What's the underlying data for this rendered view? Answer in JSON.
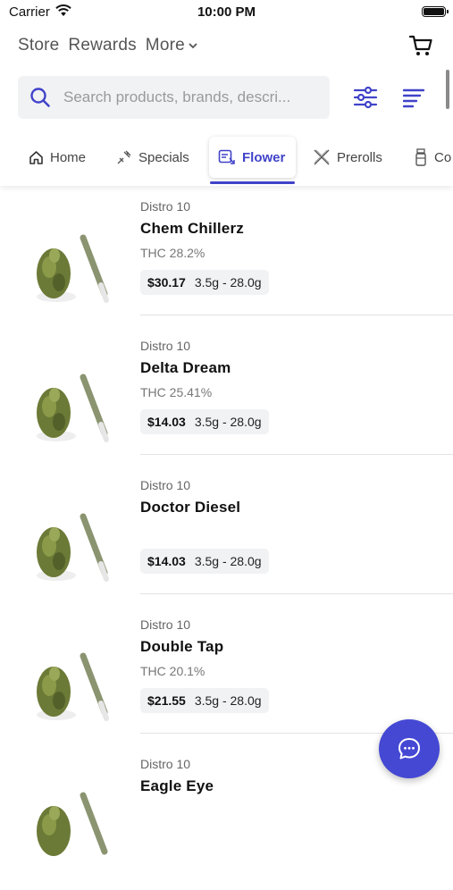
{
  "status": {
    "carrier": "Carrier",
    "time": "10:00 PM"
  },
  "nav": {
    "store": "Store",
    "rewards": "Rewards",
    "more": "More"
  },
  "search": {
    "placeholder": "Search products, brands, descri..."
  },
  "tabs": [
    {
      "label": "Home",
      "icon": "home-icon"
    },
    {
      "label": "Specials",
      "icon": "specials-icon"
    },
    {
      "label": "Flower",
      "icon": "flower-icon",
      "active": true
    },
    {
      "label": "Prerolls",
      "icon": "prerolls-icon"
    },
    {
      "label": "Co",
      "icon": "concentrates-icon"
    }
  ],
  "accent_color": "#4043c9",
  "products": [
    {
      "brand": "Distro 10",
      "name": "Chem Chillerz",
      "thc": "THC 28.2%",
      "price": "$30.17",
      "weights": "3.5g - 28.0g"
    },
    {
      "brand": "Distro 10",
      "name": "Delta Dream",
      "thc": "THC 25.41%",
      "price": "$14.03",
      "weights": "3.5g - 28.0g"
    },
    {
      "brand": "Distro 10",
      "name": "Doctor Diesel",
      "thc": "",
      "price": "$14.03",
      "weights": "3.5g - 28.0g"
    },
    {
      "brand": "Distro 10",
      "name": "Double Tap",
      "thc": "THC 20.1%",
      "price": "$21.55",
      "weights": "3.5g - 28.0g"
    },
    {
      "brand": "Distro 10",
      "name": "Eagle Eye",
      "thc": "",
      "price": "",
      "weights": ""
    }
  ]
}
